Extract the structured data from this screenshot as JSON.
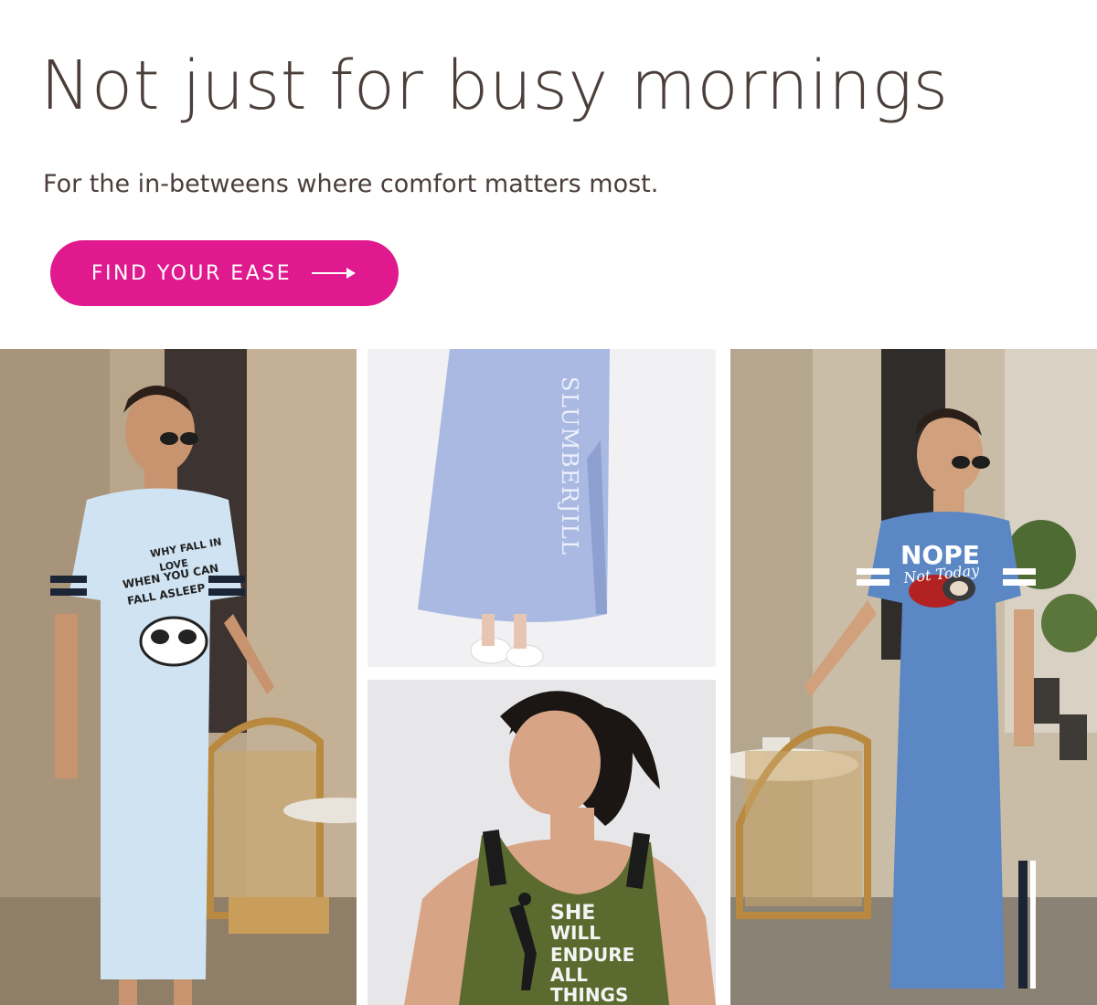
{
  "hero": {
    "title": "Not just for busy mornings",
    "subtitle": "For the in-betweens where comfort matters most.",
    "cta_label": "FIND YOUR EASE",
    "cta_icon": "arrow-right-icon"
  },
  "colors": {
    "cta_background": "#e01a8e",
    "heading_text": "#4b3f3b",
    "light_blue_dress": "#cfe3f3",
    "blue_dress": "#5b87c4",
    "lavender_skirt": "#a9b9e2",
    "olive_tank": "#5b6b2f"
  },
  "gallery": {
    "left": {
      "alt": "Woman in light blue t-shirt dress with panda print",
      "print_lines": [
        "WHY FALL IN",
        "LOVE",
        "WHEN YOU CAN",
        "FALL ASLEEP"
      ]
    },
    "mid_top": {
      "alt": "Close-up of lavender long skirt dress",
      "brand_text": "SLUMBERJILL"
    },
    "mid_bottom": {
      "alt": "Woman in olive green tank top",
      "print_lines": [
        "SHE",
        "WILL",
        "ENDURE",
        "ALL",
        "THINGS"
      ]
    },
    "right": {
      "alt": "Woman in blue t-shirt dress with sloth print",
      "print_big": "NOPE",
      "print_script": "Not Today"
    }
  }
}
